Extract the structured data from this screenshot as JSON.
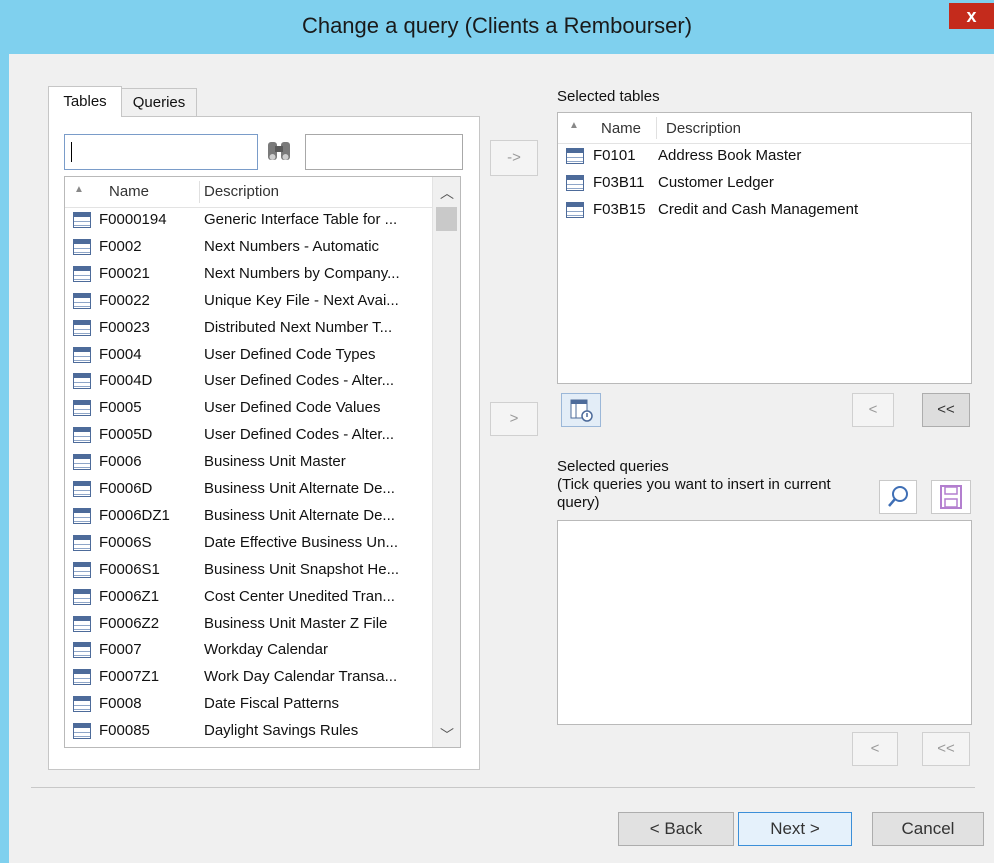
{
  "window": {
    "title": "Change a query (Clients a Rembourser)",
    "close_glyph": "x"
  },
  "tabs": [
    {
      "label": "Tables"
    },
    {
      "label": "Queries"
    }
  ],
  "left": {
    "search_value": "",
    "filter_value": "",
    "columns": {
      "sort_glyph": "▲",
      "name": "Name",
      "description": "Description"
    },
    "rows": [
      {
        "name": "F0000194",
        "description": "Generic Interface Table for ..."
      },
      {
        "name": "F0002",
        "description": "Next Numbers - Automatic"
      },
      {
        "name": "F00021",
        "description": "Next Numbers by Company..."
      },
      {
        "name": "F00022",
        "description": "Unique Key File - Next Avai..."
      },
      {
        "name": "F00023",
        "description": "Distributed Next Number T..."
      },
      {
        "name": "F0004",
        "description": "User Defined Code Types"
      },
      {
        "name": "F0004D",
        "description": "User Defined Codes - Alter..."
      },
      {
        "name": "F0005",
        "description": "User Defined Code Values"
      },
      {
        "name": "F0005D",
        "description": "User Defined Codes - Alter..."
      },
      {
        "name": "F0006",
        "description": "Business Unit Master"
      },
      {
        "name": "F0006D",
        "description": "Business Unit Alternate De..."
      },
      {
        "name": "F0006DZ1",
        "description": "Business Unit Alternate De..."
      },
      {
        "name": "F0006S",
        "description": "Date Effective Business Un..."
      },
      {
        "name": "F0006S1",
        "description": "Business Unit Snapshot He..."
      },
      {
        "name": "F0006Z1",
        "description": "Cost Center Unedited Tran..."
      },
      {
        "name": "F0006Z2",
        "description": "Business Unit Master Z File"
      },
      {
        "name": "F0007",
        "description": "Workday Calendar"
      },
      {
        "name": "F0007Z1",
        "description": "Work Day Calendar Transa..."
      },
      {
        "name": "F0008",
        "description": "Date Fiscal Patterns"
      },
      {
        "name": "F00085",
        "description": "Daylight Savings Rules"
      }
    ]
  },
  "middle": {
    "arrow_add_label": "->",
    "add_query_label": ">"
  },
  "selected_tables": {
    "label": "Selected tables",
    "columns": {
      "sort_glyph": "▲",
      "name": "Name",
      "description": "Description"
    },
    "rows": [
      {
        "name": "F0101",
        "description": "Address Book Master"
      },
      {
        "name": "F03B11",
        "description": "Customer Ledger"
      },
      {
        "name": "F03B15",
        "description": "Credit and Cash Management"
      }
    ],
    "remove_one_label": "<",
    "remove_all_label": "<<"
  },
  "selected_queries": {
    "label_line1": "Selected queries",
    "label_line2": "(Tick queries you want to insert in current",
    "label_line3": "query)",
    "remove_one_label": "<",
    "remove_all_label": "<<"
  },
  "footer": {
    "back_label": "< Back",
    "next_label": "Next >",
    "cancel_label": "Cancel"
  },
  "icons": {
    "search": "binoculars-icon",
    "table": "table-icon",
    "table_link": "table-link-icon",
    "magnify": "magnifier-icon",
    "save": "save-icon"
  },
  "colors": {
    "titlebar": "#7fd0ee",
    "close": "#c42b1c",
    "dialog": "#f0f0f0"
  }
}
